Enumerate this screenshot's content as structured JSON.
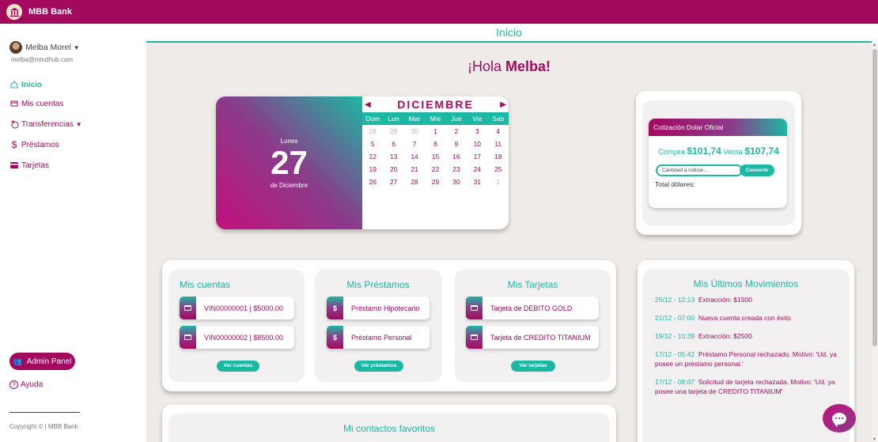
{
  "app": {
    "brand": "MBB Bank"
  },
  "user": {
    "name": "Melba Morel",
    "email": "melba@mindhub.com"
  },
  "sidebar": {
    "items": [
      {
        "label": "Inicio",
        "icon": "home-icon"
      },
      {
        "label": "Mis cuentas",
        "icon": "wallet-icon"
      },
      {
        "label": "Transferencias",
        "icon": "transfer-icon"
      },
      {
        "label": "Préstamos",
        "icon": "dollar-icon"
      },
      {
        "label": "Tarjetas",
        "icon": "credit-card-icon"
      }
    ],
    "admin_label": "Admin Panel",
    "help_label": "Ayuda",
    "copyright": "Copyright © | MBB Bank"
  },
  "header": {
    "title": "Inicio"
  },
  "greeting": {
    "prefix": "¡Hola ",
    "name": "Melba!"
  },
  "calendar": {
    "weekday": "Lunes",
    "day": "27",
    "date_text": "de Diciembre",
    "month": "DICIEMBRE",
    "dow": [
      "Dom",
      "Lun",
      "Mar",
      "Mie",
      "Jue",
      "Vie",
      "Sab"
    ],
    "weeks": [
      [
        "28",
        "29",
        "30",
        "1",
        "2",
        "3",
        "4"
      ],
      [
        "5",
        "6",
        "7",
        "8",
        "9",
        "10",
        "11"
      ],
      [
        "12",
        "13",
        "14",
        "15",
        "16",
        "17",
        "18"
      ],
      [
        "19",
        "20",
        "21",
        "22",
        "23",
        "24",
        "25"
      ],
      [
        "26",
        "27",
        "28",
        "29",
        "30",
        "31",
        "1"
      ]
    ]
  },
  "quote": {
    "title": "Cotización Dolar Oficial",
    "buy_label": "Compra",
    "buy_value": "$101,74",
    "sell_label": "Venta",
    "sell_value": "$107,74",
    "input_placeholder": "Cantidad a cotizar...",
    "button": "Convertir",
    "total_label": "Total dólares:"
  },
  "accounts": {
    "title": "Mis cuentas",
    "items": [
      "VIN00000001 | $5000.00",
      "VIN00000002 | $8500.00"
    ],
    "button": "Ver cuentas"
  },
  "loans": {
    "title": "Mis Préstamos",
    "items": [
      "Préstamo Hipotecario",
      "Préstamo Personal"
    ],
    "tag": "$",
    "button": "Ver préstamos"
  },
  "cards": {
    "title": "Mis Tarjetas",
    "items": [
      "Tarjeta de DEBITO GOLD",
      "Tarjeta de CREDITO TITANIUM"
    ],
    "button": "Ver tarjetas"
  },
  "movements": {
    "title": "Mis Últimos Movimientos",
    "items": [
      {
        "time": "25/12 - 12:13",
        "text": "Extracción: $1500"
      },
      {
        "time": "21/12 - 07:00",
        "text": "Nueva cuenta creada con éxito"
      },
      {
        "time": "19/12 - 10:39",
        "text": "Extracción: $2500"
      },
      {
        "time": "17/12 - 05:42",
        "text": "Préstamo Personal rechazado. Motivo: 'Ud. ya posee un préstamo personal.'"
      },
      {
        "time": "17/12 - 08:07",
        "text": "Solicitud de tarjeta rechazada. Motivo: 'Ud. ya posee una tarjeta de CREDITO TITANIUM'"
      }
    ]
  },
  "contacts": {
    "title": "Mi contactos favoritos"
  },
  "colors": {
    "brand": "#a30a5e",
    "accent": "#1cb8a3",
    "background": "#efebe9"
  }
}
